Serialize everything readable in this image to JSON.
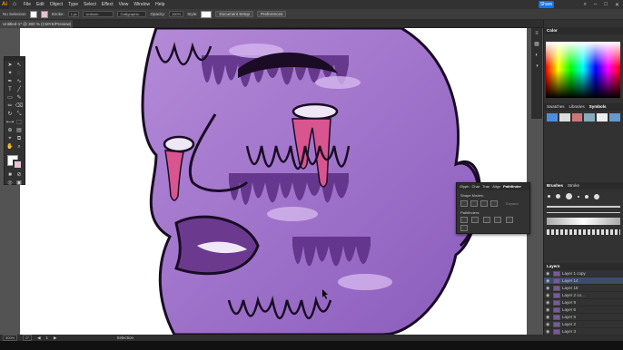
{
  "app": {
    "logo": "Ai"
  },
  "menu": [
    "File",
    "Edit",
    "Object",
    "Type",
    "Select",
    "Effect",
    "View",
    "Window",
    "Help"
  ],
  "share_label": "Share",
  "control_bar": {
    "selection_label": "No Selection",
    "stroke_label": "Stroke:",
    "stroke_value": "1 pt",
    "stroke_style": "Uniform",
    "brush": "Calligraphic",
    "opacity_label": "Opacity:",
    "opacity_value": "100%",
    "style_label": "Style:",
    "doc_setup": "Document Setup",
    "preferences": "Preferences"
  },
  "document_tab": "Untitled-1* @ 300 % (CMYK/Preview)",
  "panels": {
    "color_title": "Color",
    "swatch_tabs": [
      "Swatches",
      "Libraries",
      "Symbols"
    ],
    "brush_tabs": [
      "Brushes",
      "Stroke"
    ],
    "layers_title": "Layers"
  },
  "pathfinder": {
    "tabs": [
      "Glyph",
      "Char",
      "Tran",
      "Align",
      "Pathfinder"
    ],
    "shape_modes_label": "Shape Modes:",
    "pathfinders_label": "Pathfinders:",
    "expand_label": "Expand"
  },
  "layers": [
    {
      "name": "Layer 1 copy"
    },
    {
      "name": "Layer 14"
    },
    {
      "name": "Layer 18"
    },
    {
      "name": "Layer 2 co..."
    },
    {
      "name": "Layer 9"
    },
    {
      "name": "Layer 6"
    },
    {
      "name": "Layer 5"
    },
    {
      "name": "Layer 2"
    },
    {
      "name": "Layer 3"
    },
    {
      "name": "Layer 4"
    }
  ],
  "status": {
    "zoom": "300%",
    "rotation": "0°",
    "artboard": "1",
    "tool": "Selection"
  },
  "colors": {
    "accent": "#1473e6",
    "purple_main": "#9b6fc8",
    "purple_dark": "#5a2d82",
    "pink": "#d9558f"
  },
  "icons": [
    "home-icon",
    "selection-tool-icon",
    "pen-tool-icon",
    "type-tool-icon",
    "eye-icon",
    "search-icon"
  ]
}
